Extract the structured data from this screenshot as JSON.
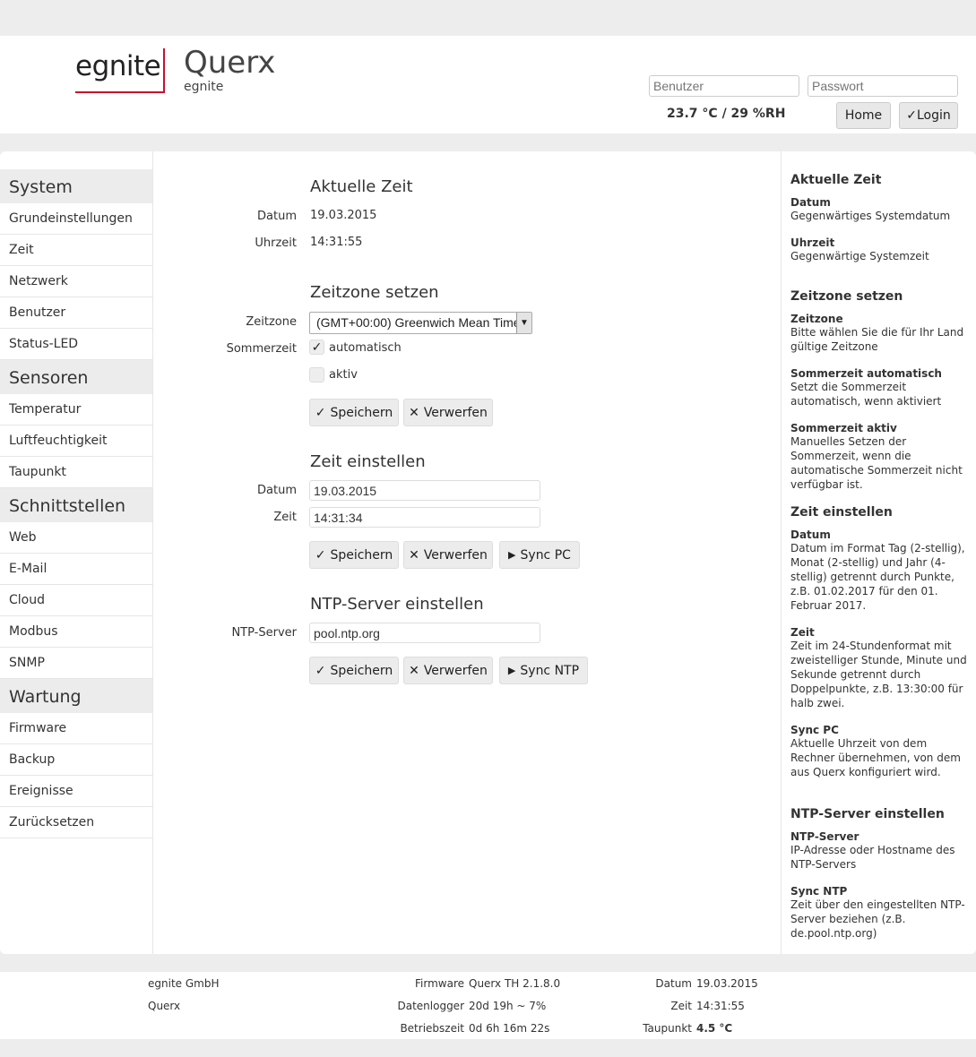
{
  "header": {
    "logo_text": "egnite",
    "app_title": "Querx",
    "app_subtitle": "egnite",
    "username_placeholder": "Benutzer",
    "password_placeholder": "Passwort",
    "sensor_reading": "23.7 °C / 29 %RH",
    "home_label": "Home",
    "login_label": "Login",
    "login_icon": "✓"
  },
  "sidebar": {
    "groups": [
      {
        "title": "System",
        "items": [
          "Grundeinstellungen",
          "Zeit",
          "Netzwerk",
          "Benutzer",
          "Status-LED"
        ]
      },
      {
        "title": "Sensoren",
        "items": [
          "Temperatur",
          "Luftfeuchtigkeit",
          "Taupunkt"
        ]
      },
      {
        "title": "Schnittstellen",
        "items": [
          "Web",
          "E-Mail",
          "Cloud",
          "Modbus",
          "SNMP"
        ]
      },
      {
        "title": "Wartung",
        "items": [
          "Firmware",
          "Backup",
          "Ereignisse",
          "Zurücksetzen"
        ]
      }
    ]
  },
  "main": {
    "current_time": {
      "title": "Aktuelle Zeit",
      "date_label": "Datum",
      "date_value": "19.03.2015",
      "time_label": "Uhrzeit",
      "time_value": "14:31:55"
    },
    "timezone": {
      "title": "Zeitzone setzen",
      "zone_label": "Zeitzone",
      "zone_value": "(GMT+00:00) Greenwich Mean Time",
      "dst_label": "Sommerzeit",
      "auto_label": "automatisch",
      "auto_checked": true,
      "active_label": "aktiv",
      "active_checked": false
    },
    "set_time": {
      "title": "Zeit einstellen",
      "date_label": "Datum",
      "date_value": "19.03.2015",
      "time_label": "Zeit",
      "time_value": "14:31:34"
    },
    "ntp": {
      "title": "NTP-Server einstellen",
      "server_label": "NTP-Server",
      "server_value": "pool.ntp.org"
    },
    "buttons": {
      "save": "Speichern",
      "discard": "Verwerfen",
      "sync_pc": "Sync PC",
      "sync_ntp": "Sync NTP",
      "save_icon": "✓",
      "discard_icon": "✕",
      "play_icon": "▶"
    }
  },
  "help": {
    "current_time": {
      "title": "Aktuelle Zeit",
      "items": [
        {
          "term": "Datum",
          "desc": "Gegenwärtiges Systemdatum"
        },
        {
          "term": "Uhrzeit",
          "desc": "Gegenwärtige Systemzeit"
        }
      ]
    },
    "timezone": {
      "title": "Zeitzone setzen",
      "items": [
        {
          "term": "Zeitzone",
          "desc": "Bitte wählen Sie die für Ihr Land gültige Zeitzone"
        },
        {
          "term": "Sommerzeit automatisch",
          "desc": "Setzt die Sommerzeit automatisch, wenn aktiviert"
        },
        {
          "term": "Sommerzeit aktiv",
          "desc": "Manuelles Setzen der Sommerzeit, wenn die automatische Sommerzeit nicht verfügbar ist."
        }
      ]
    },
    "set_time": {
      "title": "Zeit einstellen",
      "items": [
        {
          "term": "Datum",
          "desc": "Datum im Format Tag (2-stellig), Monat (2-stellig) und Jahr (4-stellig) getrennt durch Punkte, z.B. 01.02.2017 für den 01. Februar 2017."
        },
        {
          "term": "Zeit",
          "desc": "Zeit im 24-Stundenformat mit zweistelliger Stunde, Minute und Sekunde getrennt durch Doppelpunkte, z.B. 13:30:00 für halb zwei."
        },
        {
          "term": "Sync PC",
          "desc": "Aktuelle Uhrzeit von dem Rechner übernehmen, von dem aus Querx konfiguriert wird."
        }
      ]
    },
    "ntp": {
      "title": "NTP-Server einstellen",
      "items": [
        {
          "term": "NTP-Server",
          "desc": "IP-Adresse oder Hostname des NTP-Servers"
        },
        {
          "term": "Sync NTP",
          "desc": "Zeit über den eingestellten NTP-Server beziehen (z.B. de.pool.ntp.org)"
        }
      ]
    }
  },
  "footer": {
    "company": "egnite GmbH",
    "product": "Querx",
    "firmware_label": "Firmware",
    "firmware_value": "Querx TH 2.1.8.0",
    "logger_label": "Datenlogger",
    "logger_value": "20d 19h ~ 7%",
    "uptime_label": "Betriebszeit",
    "uptime_value": "0d 6h 16m 22s",
    "date_label": "Datum",
    "date_value": "19.03.2015",
    "time_label": "Zeit",
    "time_value": "14:31:55",
    "dewpoint_label": "Taupunkt",
    "dewpoint_value": "4.5 °C"
  },
  "colors": {
    "brand_red": "#c8102e",
    "page_bg": "#ededed",
    "sidebar_group_bg": "#ececec"
  }
}
